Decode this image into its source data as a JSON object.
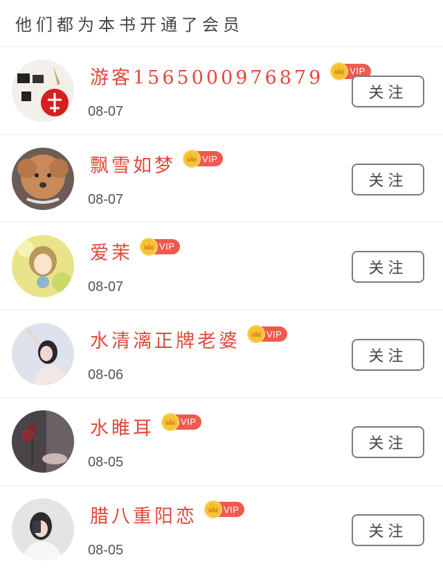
{
  "header": {
    "title": "他们都为本书开通了会员"
  },
  "badge": {
    "vip_label": "VIP"
  },
  "members": [
    {
      "name": "游客1565000976879",
      "date": "08-07",
      "follow_label": "关注",
      "avatar": "avatar-calligraphy"
    },
    {
      "name": "飘雪如梦",
      "date": "08-07",
      "follow_label": "关注",
      "avatar": "avatar-poodle"
    },
    {
      "name": "爱茉",
      "date": "08-07",
      "follow_label": "关注",
      "avatar": "avatar-anime-girl"
    },
    {
      "name": "水清漓正牌老婆",
      "date": "08-06",
      "follow_label": "关注",
      "avatar": "avatar-woman-photo"
    },
    {
      "name": "水睢耳",
      "date": "08-05",
      "follow_label": "关注",
      "avatar": "avatar-dark-still-life"
    },
    {
      "name": "腊八重阳恋",
      "date": "08-05",
      "follow_label": "关注",
      "avatar": "avatar-selfie"
    }
  ],
  "colors": {
    "name": "#e2483a",
    "vip_bg": "#ef5a4f",
    "crown": "#f7c230",
    "button_border": "#7a7a7a"
  }
}
